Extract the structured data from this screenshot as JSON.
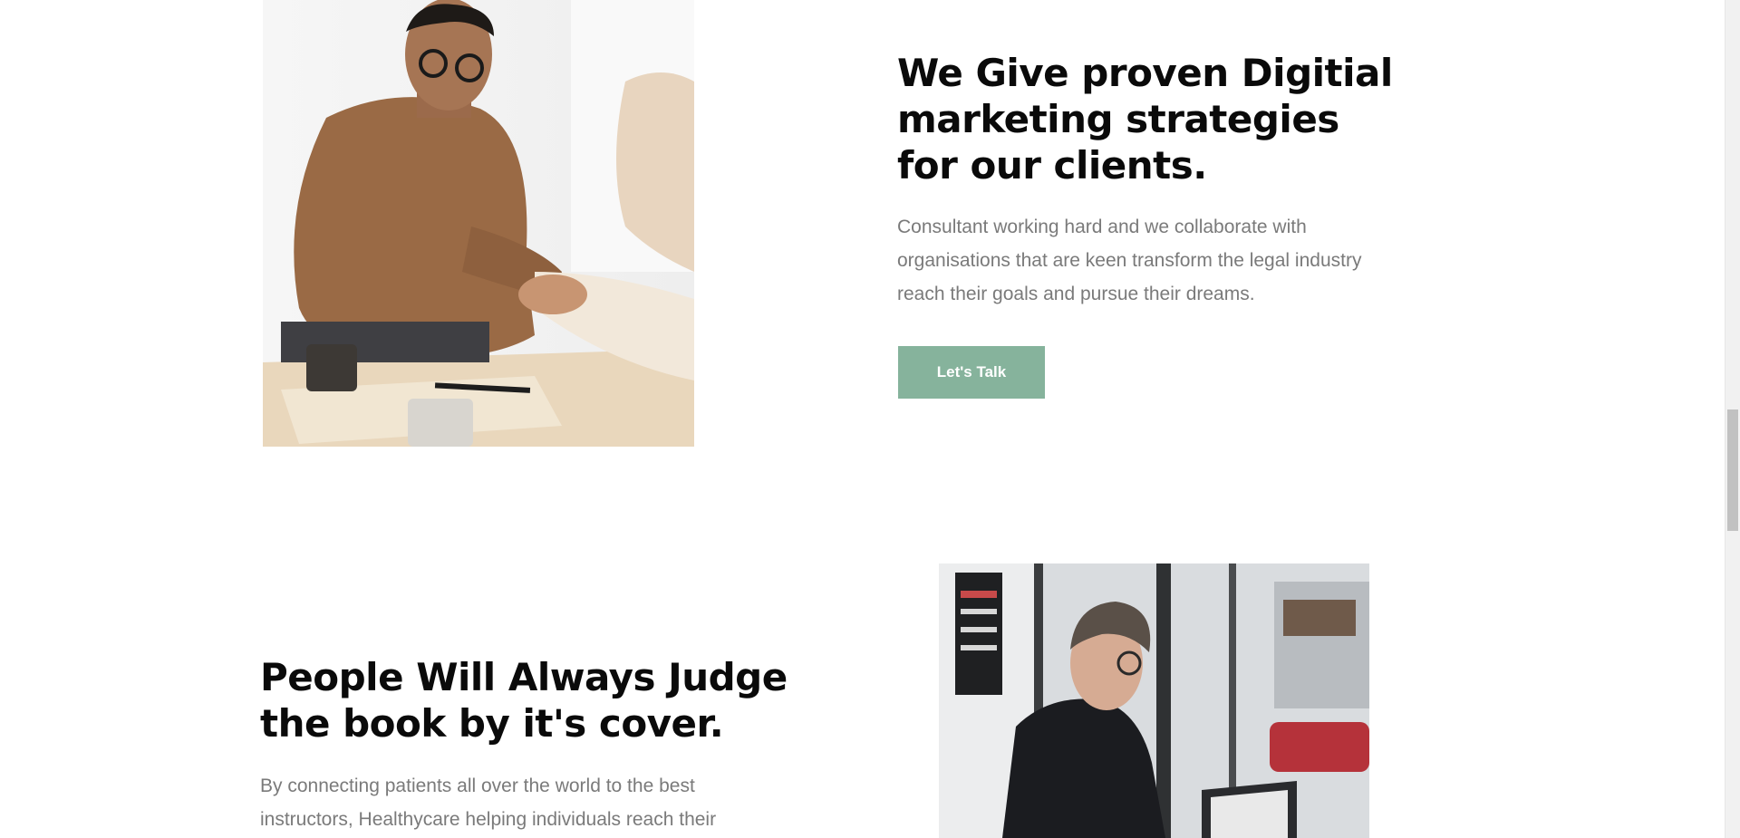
{
  "section_1": {
    "heading": "We Give proven Digitial marketing strategies for our clients.",
    "body": "Consultant working hard and we collaborate with organisations that are keen transform the legal industry reach their goals and pursue their dreams.",
    "cta_label": "Let's Talk"
  },
  "section_2": {
    "heading": "People Will Always Judge the book by it's cover.",
    "body": "By connecting patients all over the world to the best instructors, Healthycare helping individuals reach their"
  },
  "colors": {
    "accent": "#86b39c",
    "heading": "#0a0a0a",
    "body_text": "#7a7a7a",
    "background": "#ffffff"
  }
}
